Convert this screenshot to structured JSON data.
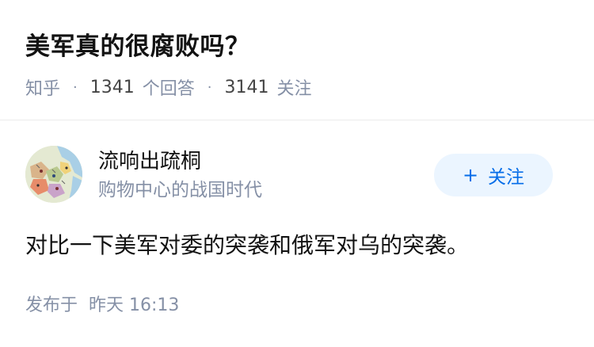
{
  "question": {
    "title": "美军真的很腐败吗？",
    "meta": {
      "source": "知乎",
      "separator": "·",
      "answer_count": "1341",
      "answer_label": "个回答",
      "follower_count": "3141",
      "follower_label": "关注"
    }
  },
  "author": {
    "name": "流响出疏桐",
    "headline": "购物中心的战国时代",
    "avatar_icon": "map-avatar",
    "follow_button": {
      "icon": "plus-icon",
      "plus": "+",
      "label": "关注"
    }
  },
  "answer": {
    "content": "对比一下美军对委的突袭和俄军对乌的突袭。",
    "published_label": "发布于",
    "published_time": "昨天 16:13"
  },
  "colors": {
    "text_primary": "#121212",
    "text_secondary": "#8590a6",
    "accent": "#056de8",
    "follow_bg": "#ebf5ff",
    "divider": "#ebebeb"
  }
}
